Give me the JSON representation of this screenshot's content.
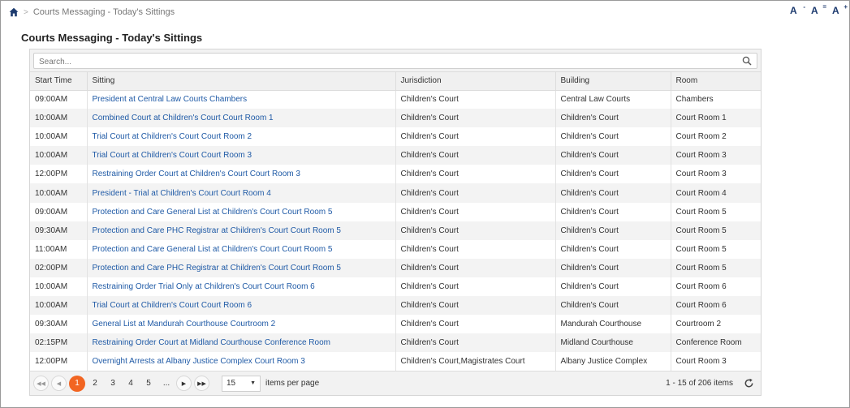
{
  "breadcrumb": {
    "separator": ">",
    "current": "Courts Messaging - Today's Sittings"
  },
  "font_tools": [
    {
      "name": "decrease-font-button",
      "label": "A",
      "sup": "-"
    },
    {
      "name": "reset-font-button",
      "label": "A",
      "sup": "="
    },
    {
      "name": "increase-font-button",
      "label": "A",
      "sup": "+"
    }
  ],
  "page_title": "Courts Messaging - Today's Sittings",
  "search": {
    "placeholder": "Search..."
  },
  "table": {
    "columns": [
      "Start Time",
      "Sitting",
      "Jurisdiction",
      "Building",
      "Room"
    ],
    "rows": [
      [
        "09:00AM",
        "President at Central Law Courts Chambers",
        "Children's Court",
        "Central Law Courts",
        "Chambers"
      ],
      [
        "10:00AM",
        "Combined Court at Children's Court Court Room 1",
        "Children's Court",
        "Children's Court",
        "Court Room 1"
      ],
      [
        "10:00AM",
        "Trial Court at Children's Court Court Room 2",
        "Children's Court",
        "Children's Court",
        "Court Room 2"
      ],
      [
        "10:00AM",
        "Trial Court at Children's Court Court Room 3",
        "Children's Court",
        "Children's Court",
        "Court Room 3"
      ],
      [
        "12:00PM",
        "Restraining Order Court at Children's Court Court Room 3",
        "Children's Court",
        "Children's Court",
        "Court Room 3"
      ],
      [
        "10:00AM",
        "President - Trial at Children's Court Court Room 4",
        "Children's Court",
        "Children's Court",
        "Court Room 4"
      ],
      [
        "09:00AM",
        "Protection and Care General List at Children's Court Court Room 5",
        "Children's Court",
        "Children's Court",
        "Court Room 5"
      ],
      [
        "09:30AM",
        "Protection and Care PHC Registrar at Children's Court Court Room 5",
        "Children's Court",
        "Children's Court",
        "Court Room 5"
      ],
      [
        "11:00AM",
        "Protection and Care General List at Children's Court Court Room 5",
        "Children's Court",
        "Children's Court",
        "Court Room 5"
      ],
      [
        "02:00PM",
        "Protection and Care PHC Registrar at Children's Court Court Room 5",
        "Children's Court",
        "Children's Court",
        "Court Room 5"
      ],
      [
        "10:00AM",
        "Restraining Order Trial Only at Children's Court Court Room 6",
        "Children's Court",
        "Children's Court",
        "Court Room 6"
      ],
      [
        "10:00AM",
        "Trial Court at Children's Court Court Room 6",
        "Children's Court",
        "Children's Court",
        "Court Room 6"
      ],
      [
        "09:30AM",
        "General List at Mandurah Courthouse Courtroom 2",
        "Children's Court",
        "Mandurah Courthouse",
        "Courtroom 2"
      ],
      [
        "02:15PM",
        "Restraining Order Court at Midland Courthouse Conference Room",
        "Children's Court",
        "Midland Courthouse",
        "Conference Room"
      ],
      [
        "12:00PM",
        "Overnight Arrests at Albany Justice Complex Court Room 3",
        "Children's Court,Magistrates Court",
        "Albany Justice Complex",
        "Court Room 3"
      ]
    ]
  },
  "pager": {
    "first": "◀◀",
    "prev": "◀",
    "pages": [
      "1",
      "2",
      "3",
      "4",
      "5",
      "..."
    ],
    "current_page": "1",
    "next": "▶",
    "last": "▶▶",
    "page_size": "15",
    "items_per_page_label": "items per page",
    "info": "1 - 15 of 206 items"
  },
  "colors": {
    "accent": "#f26522",
    "link": "#1f5aa6",
    "brand": "#1c3a6e"
  }
}
